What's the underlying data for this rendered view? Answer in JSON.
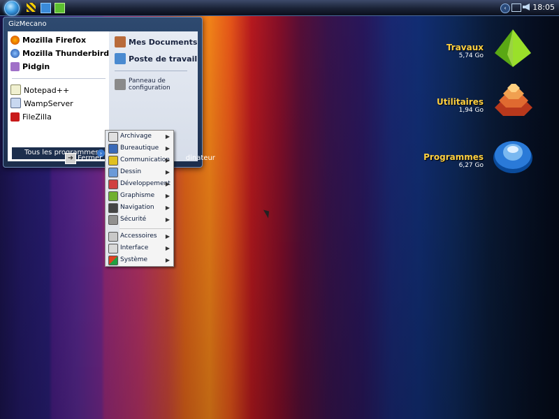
{
  "taskbar": {
    "clock": "18:05"
  },
  "start_menu": {
    "user": "GizMecano",
    "pinned": [
      "Mozilla Firefox",
      "Mozilla Thunderbird",
      "Pidgin"
    ],
    "recent": [
      "Notepad++",
      "WampServer",
      "FileZilla"
    ],
    "all_programs": "Tous les programmes",
    "right": {
      "docs": "Mes Documents",
      "computer": "Poste de travail",
      "control_panel_1": "Panneau de",
      "control_panel_2": "configuration"
    },
    "shutdown": "Fermer la s",
    "shutdown_tail": "dinateur"
  },
  "submenu": [
    "Archivage",
    "Bureautique",
    "Communication",
    "Dessin",
    "Développement",
    "Graphisme",
    "Navigation",
    "Sécurité",
    "Accessoires",
    "Interface",
    "Système"
  ],
  "desktop": [
    {
      "label": "Travaux",
      "size": "5,74 Go",
      "color": "#7ac81e"
    },
    {
      "label": "Utilitaires",
      "size": "1,94 Go",
      "color": "#c84a1e"
    },
    {
      "label": "Programmes",
      "size": "6,27 Go",
      "color": "#1e70c8"
    }
  ]
}
